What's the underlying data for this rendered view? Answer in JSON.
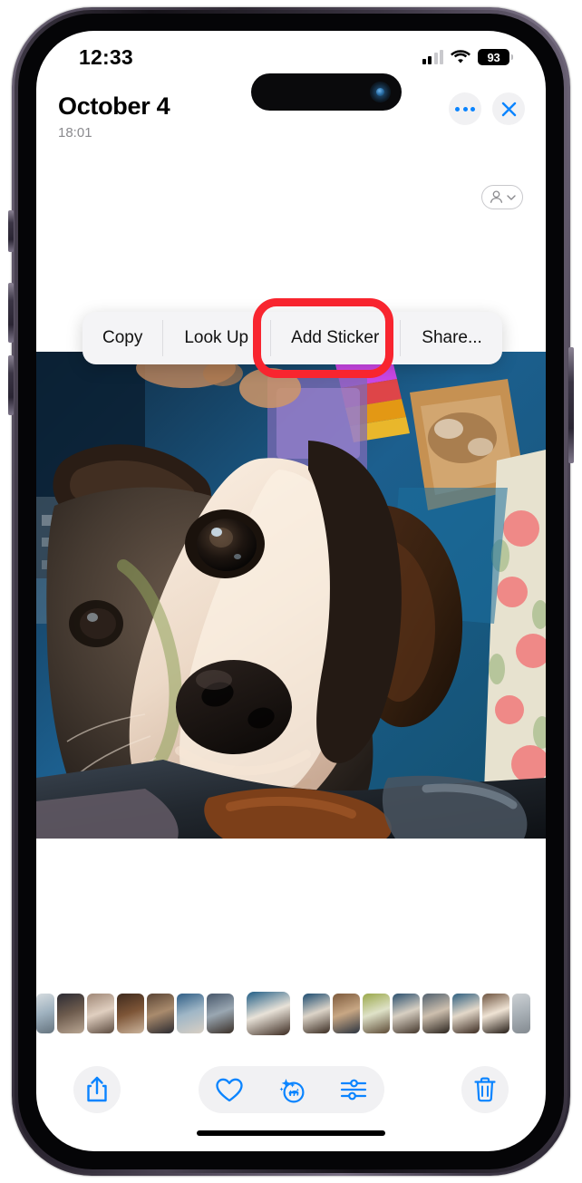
{
  "status_bar": {
    "time": "12:33",
    "battery_percent": "93",
    "cellular_icon": "cellular-signal-icon",
    "wifi_icon": "wifi-icon",
    "battery_icon": "battery-icon"
  },
  "header": {
    "date": "October 4",
    "time": "18:01",
    "more_icon": "ellipsis-icon",
    "close_icon": "close-x-icon",
    "people_icon": "person-icon",
    "people_chevron_icon": "chevron-down-icon"
  },
  "context_menu": {
    "items": [
      {
        "label": "Copy",
        "name": "copy",
        "highlighted": false
      },
      {
        "label": "Look Up",
        "name": "look-up",
        "highlighted": false
      },
      {
        "label": "Add Sticker",
        "name": "add-sticker",
        "highlighted": true
      },
      {
        "label": "Share...",
        "name": "share",
        "highlighted": false
      }
    ],
    "highlight_color": "#f8252f"
  },
  "photo": {
    "description": "close-up photo of a brown and white dog looking up",
    "alt_name": "main-photo"
  },
  "filmstrip": {
    "selected_index": 7,
    "thumbnails": [
      {
        "name": "thumbnail-1"
      },
      {
        "name": "thumbnail-2"
      },
      {
        "name": "thumbnail-3"
      },
      {
        "name": "thumbnail-4"
      },
      {
        "name": "thumbnail-5"
      },
      {
        "name": "thumbnail-6"
      },
      {
        "name": "thumbnail-7"
      },
      {
        "name": "thumbnail-8"
      },
      {
        "name": "thumbnail-9"
      },
      {
        "name": "thumbnail-10"
      },
      {
        "name": "thumbnail-11"
      },
      {
        "name": "thumbnail-12"
      },
      {
        "name": "thumbnail-13"
      },
      {
        "name": "thumbnail-14"
      },
      {
        "name": "thumbnail-15"
      },
      {
        "name": "thumbnail-16"
      }
    ]
  },
  "toolbar": {
    "accent_color": "#0a84ff",
    "share_icon": "share-icon",
    "favorite_icon": "heart-icon",
    "visual_lookup_icon": "visual-lookup-dog-icon",
    "adjust_icon": "adjustments-sliders-icon",
    "trash_icon": "trash-icon"
  },
  "system": {
    "home_indicator": "home-indicator",
    "dynamic_island": "dynamic-island",
    "front_camera": "front-camera-lens",
    "action_button": "action-button",
    "volume_up_button": "volume-up-button",
    "volume_down_button": "volume-down-button",
    "power_button": "power-button"
  }
}
